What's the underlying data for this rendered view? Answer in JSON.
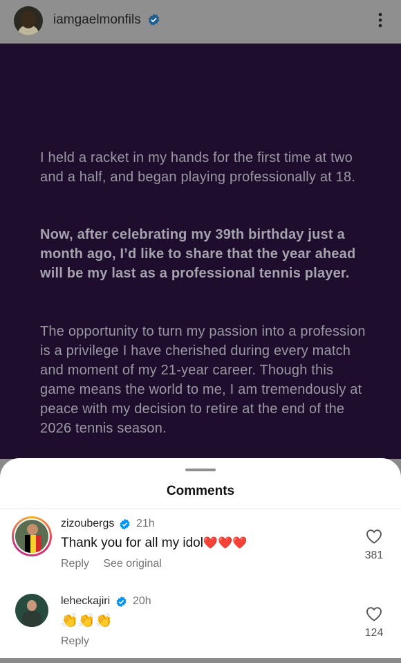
{
  "header": {
    "username": "iamgaelmonfils",
    "verified_icon": "verified-badge-icon",
    "more_icon": "more-vertical-icon"
  },
  "post": {
    "paragraph_1": "I held a racket in my hands for the first time at two and a half, and began playing professionally at 18.",
    "paragraph_2": "Now, after celebrating my 39th birthday just a month ago, I’d like to share that the year ahead will be my last as a professional tennis player.",
    "paragraph_3": "The opportunity to turn my passion into a profession is a privilege I have cherished during every match and moment of my 21-year career. Though this game means the world to me, I am tremendously at peace with my decision to retire at the end of the 2026 tennis season."
  },
  "comments_sheet": {
    "title": "Comments",
    "comments": [
      {
        "username": "zizoubergs",
        "time": "21h",
        "text": "Thank you for all my idol",
        "hearts": "❤️❤️❤️",
        "reply_label": "Reply",
        "see_original_label": "See original",
        "like_count": "381"
      },
      {
        "username": "leheckajiri",
        "time": "20h",
        "text": "👏👏👏",
        "reply_label": "Reply",
        "like_count": "124"
      }
    ]
  },
  "colors": {
    "post_background": "#1e0d2d",
    "verified_blue": "#0095f6",
    "sheet_background": "#ffffff"
  }
}
